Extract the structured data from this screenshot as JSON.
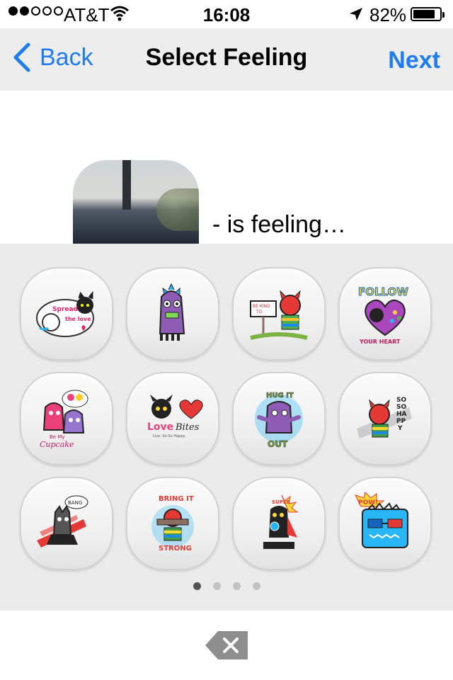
{
  "status_bar": {
    "carrier": "AT&T",
    "time": "16:08",
    "battery": "82%",
    "battery_level": 0.82,
    "signal_bars_filled": 2,
    "signal_bars_total": 5
  },
  "nav": {
    "back_label": "Back",
    "title": "Select Feeling",
    "next_label": "Next"
  },
  "profile": {
    "feeling_text": "- is feeling…"
  },
  "stickers": [
    {
      "icon": "spread-the-love-sticker",
      "text": "Spread the love"
    },
    {
      "icon": "purple-dino-sticker",
      "text": ""
    },
    {
      "icon": "be-kind-sign-sticker",
      "text": "BE KIND TO OTHERS"
    },
    {
      "icon": "follow-your-heart-sticker",
      "text": "FOLLOW YOUR HEART"
    },
    {
      "icon": "be-my-cupcake-sticker",
      "text": "Be My Cupcake"
    },
    {
      "icon": "love-bites-sticker",
      "text": "Love Bites"
    },
    {
      "icon": "hug-it-out-sticker",
      "text": "HUG IT OUT"
    },
    {
      "icon": "so-so-happy-sticker",
      "text": "SO SO HAPPY"
    },
    {
      "icon": "bang-monster-sticker",
      "text": ""
    },
    {
      "icon": "bring-it-strong-sticker",
      "text": "BRING IT STRONG"
    },
    {
      "icon": "super-monster-sticker",
      "text": ""
    },
    {
      "icon": "pow-robot-sticker",
      "text": "POW!"
    }
  ],
  "pager": {
    "pages": 4,
    "active_page": 1
  },
  "colors": {
    "accent": "#1e7cf0",
    "nav_background": "#ededed",
    "panel_background": "#ebebeb"
  }
}
